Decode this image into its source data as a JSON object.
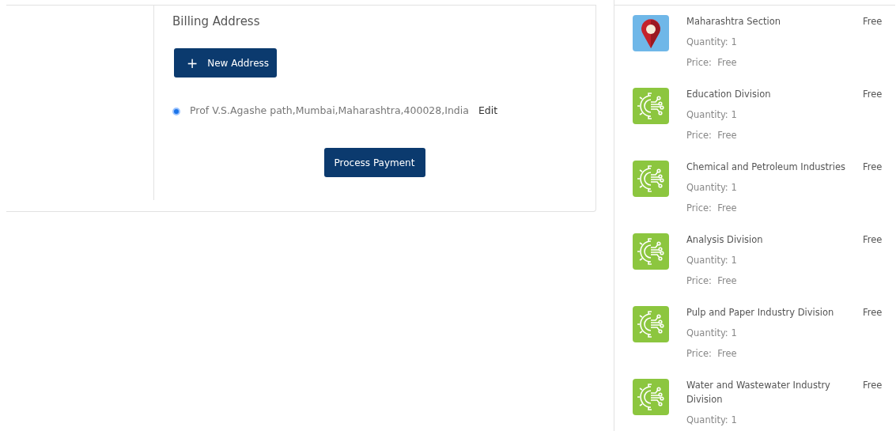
{
  "billing": {
    "title": "Billing Address",
    "new_address_button": {
      "icon": "+",
      "label": "New Address"
    },
    "addresses": [
      {
        "text": "Prof V.S.Agashe path,Mumbai,Maharashtra,400028,India",
        "selected": true,
        "edit_link": "Edit"
      }
    ],
    "submit_button": "Process Payment"
  },
  "cart_items": [
    {
      "kind": "pin",
      "name": "Maharashtra Section",
      "amount": "Free",
      "quantity": "Quantity: 1",
      "price": "Price:  Free"
    },
    {
      "kind": "gear",
      "name": "Education Division",
      "amount": "Free",
      "quantity": "Quantity: 1",
      "price": "Price:  Free"
    },
    {
      "kind": "gear",
      "name": "Chemical and Petroleum Industries",
      "amount": "Free",
      "quantity": "Quantity: 1",
      "price": "Price:  Free"
    },
    {
      "kind": "gear",
      "name": "Analysis Division",
      "amount": "Free",
      "quantity": "Quantity: 1",
      "price": "Price:  Free"
    },
    {
      "kind": "gear",
      "name": "Pulp and Paper Industry Division",
      "amount": "Free",
      "quantity": "Quantity: 1",
      "price": "Price:  Free"
    },
    {
      "kind": "gear",
      "name": "Water and Wastewater Industry Division",
      "amount": "Free",
      "quantity": "Quantity: 1"
    }
  ]
}
